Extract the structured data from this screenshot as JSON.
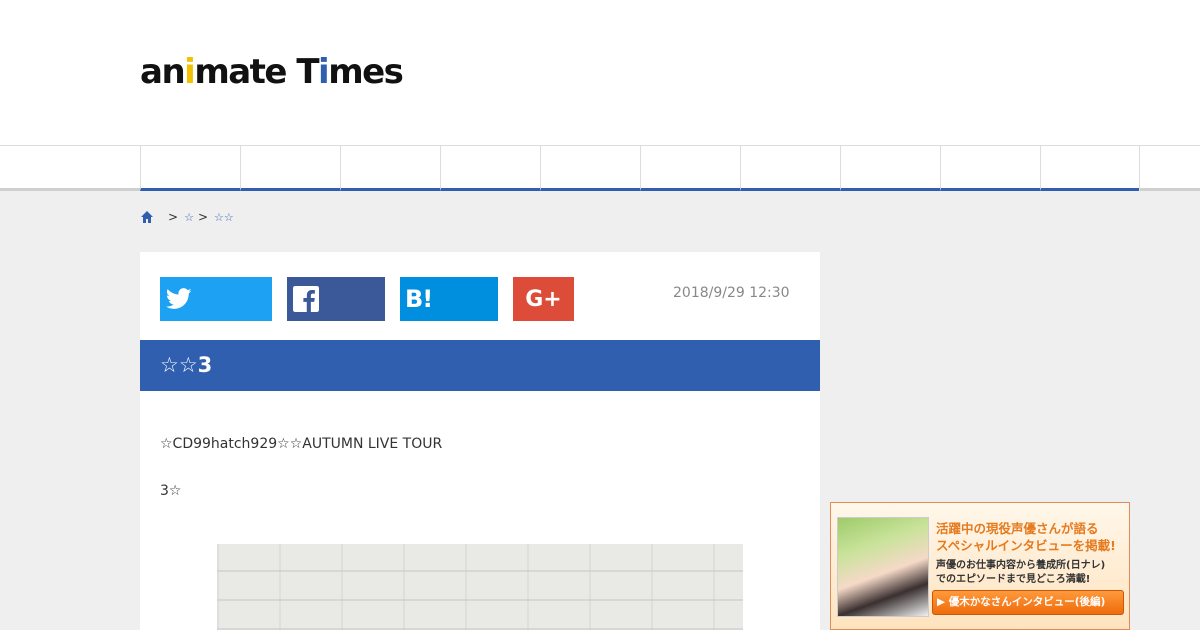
{
  "site": {
    "logo_prefix": "an",
    "logo_i": "i",
    "logo_mid": "mate T",
    "logo_i2": "i",
    "logo_suffix": "mes",
    "colors": {
      "brand_blue": "#2f5fae",
      "logo_yellow": "#f2c200"
    }
  },
  "nav": {
    "items": [
      "",
      "",
      "",
      "",
      "",
      "",
      "",
      "",
      "",
      ""
    ]
  },
  "breadcrumb": {
    "home_icon": "home-icon",
    "separator": ">",
    "items": [
      "☆",
      "☆☆"
    ]
  },
  "share": {
    "twitter_icon": "twitter-icon",
    "facebook_icon": "facebook-icon",
    "hatena_label": "B!",
    "gplus_label": "G+",
    "colors": {
      "twitter": "#1da1f2",
      "facebook": "#3b5998",
      "hatena": "#008fde",
      "gplus": "#dd4b39"
    }
  },
  "article": {
    "date": "2018/9/29 12:30",
    "title": "☆☆3",
    "paragraph1": "☆CD99hatch929☆☆AUTUMN LIVE TOUR",
    "paragraph2": "3☆"
  },
  "ad": {
    "headline1": "活躍中の現役声優さんが語る",
    "headline2": "スペシャルインタビューを掲載!",
    "sub1": "声優のお仕事内容から養成所(日ナレ)",
    "sub2": "でのエピソードまで見どころ満載!",
    "button_label": "▶ 優木かなさんインタビュー(後編)"
  }
}
